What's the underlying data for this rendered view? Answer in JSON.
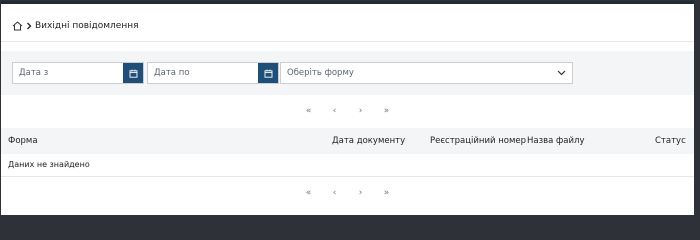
{
  "breadcrumb": {
    "icon": "home-icon",
    "separator_icon": "chevron-right-icon",
    "title": "Вихідні повідомлення"
  },
  "filters": {
    "date_from_placeholder": "Дата з",
    "date_to_placeholder": "Дата по",
    "form_select_placeholder": "Оберіть форму",
    "calendar_icon": "calendar-icon",
    "dropdown_icon": "chevron-down-icon",
    "accent": "#1f4e79"
  },
  "pagination": {
    "first": "«",
    "prev": "‹",
    "next": "›",
    "last": "»"
  },
  "table": {
    "columns": [
      "Форма",
      "Дата документу",
      "Реєстраційний номер",
      "Назва файлу",
      "Статус"
    ],
    "empty_text": "Даних не знайдено"
  }
}
